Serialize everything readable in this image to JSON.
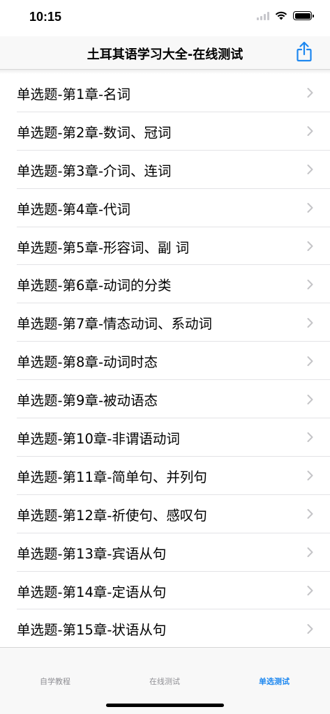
{
  "status_bar": {
    "time": "10:15",
    "icons": [
      "signal-icon",
      "wifi-icon",
      "battery-icon"
    ]
  },
  "nav": {
    "title": "土耳其语学习大全-在线测试",
    "share_icon": "share-icon",
    "accent_color": "#1e88f0"
  },
  "list": {
    "items": [
      {
        "label": "单选题-第1章-名词"
      },
      {
        "label": "单选题-第2章-数词、冠词"
      },
      {
        "label": "单选题-第3章-介词、连词"
      },
      {
        "label": "单选题-第4章-代词"
      },
      {
        "label": "单选题-第5章-形容词、副 词"
      },
      {
        "label": "单选题-第6章-动词的分类"
      },
      {
        "label": "单选题-第7章-情态动词、系动词"
      },
      {
        "label": "单选题-第8章-动词时态"
      },
      {
        "label": "单选题-第9章-被动语态"
      },
      {
        "label": "单选题-第10章-非谓语动词"
      },
      {
        "label": "单选题-第11章-简单句、并列句"
      },
      {
        "label": "单选题-第12章-祈使句、感叹句"
      },
      {
        "label": "单选题-第13章-宾语从句"
      },
      {
        "label": "单选题-第14章-定语从句"
      },
      {
        "label": "单选题-第15章-状语从句"
      }
    ],
    "chevron_icon": "chevron-right-icon"
  },
  "tab_bar": {
    "tabs": [
      {
        "label": "自学教程",
        "selected": false
      },
      {
        "label": "在线测试",
        "selected": false
      },
      {
        "label": "单选测试",
        "selected": true
      }
    ],
    "active_color": "#1e88f0",
    "inactive_color": "#8e8e93"
  }
}
